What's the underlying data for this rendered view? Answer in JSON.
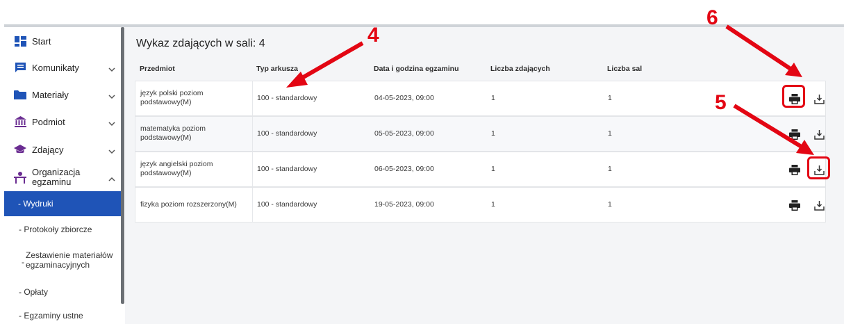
{
  "sidebar": {
    "items": [
      {
        "label": "Start",
        "icon": "dashboard-icon"
      },
      {
        "label": "Komunikaty",
        "icon": "message-icon"
      },
      {
        "label": "Materiały",
        "icon": "folder-icon"
      },
      {
        "label": "Podmiot",
        "icon": "institution-icon"
      },
      {
        "label": "Zdający",
        "icon": "graduation-cap-icon"
      },
      {
        "label": "Organizacja egzaminu",
        "icon": "desk-person-icon"
      }
    ],
    "subitems": [
      {
        "label": "- Wydruki",
        "active": true
      },
      {
        "label": "- Protokoły zbiorcze",
        "active": false
      },
      {
        "label": "Zestawienie materiałów egzaminacyjnych",
        "active": false
      },
      {
        "label": "- Opłaty",
        "active": false
      },
      {
        "label": "- Egzaminy ustne",
        "active": false
      }
    ],
    "sub_dash": "-"
  },
  "main": {
    "title": "Wykaz zdających w sali: 4",
    "columns": [
      "Przedmiot",
      "Typ arkusza",
      "Data i godzina egzaminu",
      "Liczba zdających",
      "Liczba sal"
    ],
    "rows": [
      {
        "subject": "język polski poziom podstawowy(M)",
        "type": "100 - standardowy",
        "datetime": "04-05-2023, 09:00",
        "count": "1",
        "rooms": "1"
      },
      {
        "subject": "matematyka poziom podstawowy(M)",
        "type": "100 - standardowy",
        "datetime": "05-05-2023, 09:00",
        "count": "1",
        "rooms": "1"
      },
      {
        "subject": "język angielski poziom podstawowy(M)",
        "type": "100 - standardowy",
        "datetime": "06-05-2023, 09:00",
        "count": "1",
        "rooms": "1"
      },
      {
        "subject": "fizyka poziom rozszerzony(M)",
        "type": "100 - standardowy",
        "datetime": "19-05-2023, 09:00",
        "count": "1",
        "rooms": "1"
      }
    ]
  },
  "annotations": {
    "a4": "4",
    "a5": "5",
    "a6": "6"
  },
  "colors": {
    "accent": "#1f54b7",
    "annotation": "#e30613",
    "icon": "#1f3f8f",
    "purple": "#6a2c91"
  }
}
